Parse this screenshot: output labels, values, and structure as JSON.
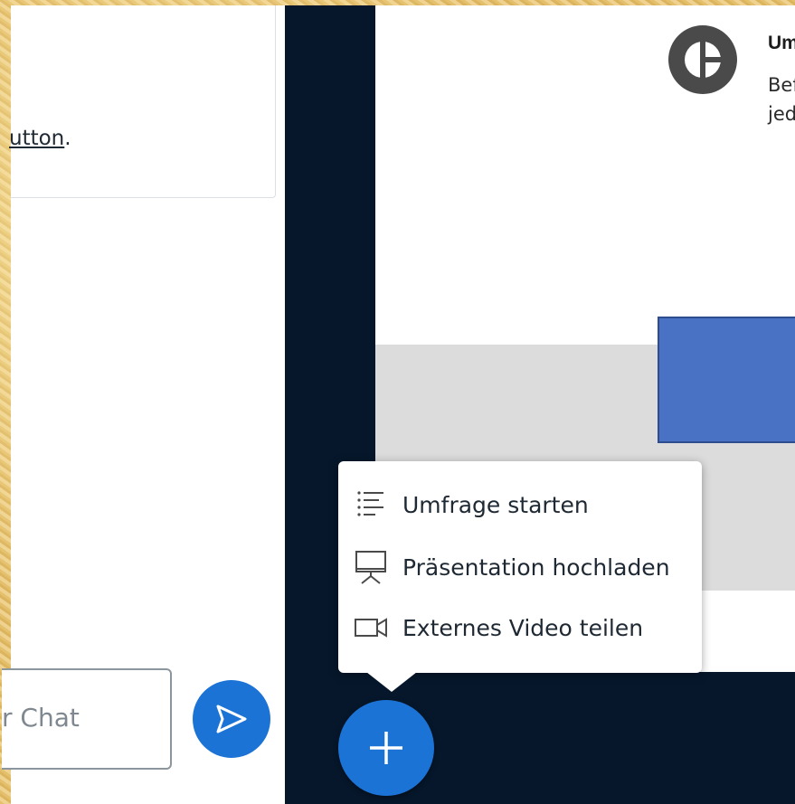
{
  "chat": {
    "message_tail": "utton",
    "message_period": ".",
    "input_placeholder_visible": "r Chat"
  },
  "poll_info": {
    "title": "Umfragen",
    "description_line1": "Befrage N",
    "description_line2": "jederzeit."
  },
  "actions_menu": {
    "items": [
      {
        "label": "Umfrage starten",
        "icon": "list-icon"
      },
      {
        "label": "Präsentation hochladen",
        "icon": "presentation-icon"
      },
      {
        "label": "Externes Video teilen",
        "icon": "video-icon"
      }
    ]
  },
  "icons": {
    "send": "send-icon",
    "add": "plus-icon",
    "poll_logo": "pie-chart-icon"
  },
  "colors": {
    "accent_blue": "#1b73d6",
    "presentation_bg": "#06172b",
    "slide_shape_blue": "#4a72c4"
  }
}
